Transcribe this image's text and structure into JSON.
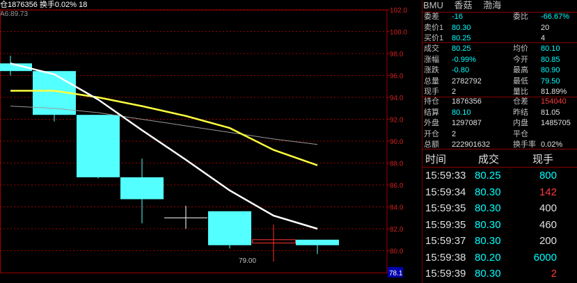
{
  "topbar": {
    "text": "仓1876356 换手0.02% 18"
  },
  "ma_legend": "A6:89.73",
  "chart_data": {
    "type": "candlestick",
    "y_ticks": [
      "102.0",
      "100.0",
      "98.0",
      "96.0",
      "94.0",
      "92.0",
      "90.0",
      "88.0",
      "86.0",
      "84.0",
      "82.0",
      "80.0"
    ],
    "ylim": [
      78.0,
      102.0
    ],
    "last_price_label": "78.1",
    "low_annotation": "79.00",
    "candles": [
      {
        "open": 96.4,
        "close": 97.1,
        "high": 97.8,
        "low": 96.0,
        "color": "cyan"
      },
      {
        "open": 96.4,
        "close": 92.4,
        "high": 96.4,
        "low": 91.8,
        "color": "cyan"
      },
      {
        "open": 92.4,
        "close": 86.7,
        "high": 92.4,
        "low": 86.6,
        "color": "cyan"
      },
      {
        "open": 86.7,
        "close": 84.7,
        "high": 88.4,
        "low": 82.5,
        "color": "cyan"
      },
      {
        "open": 83.0,
        "close": 83.0,
        "high": 84.1,
        "low": 82.0,
        "color": "cross"
      },
      {
        "open": 83.6,
        "close": 80.5,
        "high": 83.6,
        "low": 80.2,
        "color": "cyan"
      },
      {
        "open": 80.7,
        "close": 81.0,
        "high": 82.4,
        "low": 79.0,
        "color": "red"
      },
      {
        "open": 81.0,
        "close": 80.5,
        "high": 81.0,
        "low": 79.7,
        "color": "cyan"
      }
    ],
    "ma_white": [
      97.1,
      96.1,
      93.8,
      91.0,
      88.3,
      85.5,
      83.2,
      82.0
    ],
    "ma_yellow": [
      94.6,
      94.6,
      94.0,
      93.2,
      92.3,
      91.2,
      89.2,
      87.8
    ],
    "ma_gray": [
      93.2,
      93.0,
      92.6,
      92.0,
      91.4,
      90.8,
      90.2,
      89.7
    ]
  },
  "panel": {
    "title": [
      "BMU",
      "香菇",
      "渤海"
    ],
    "rows1": [
      {
        "l1": "委差",
        "v1": "-16",
        "c1": "cyan",
        "l2": "委比",
        "v2": "-66.67%",
        "c2": "cyan"
      },
      {
        "l1": "卖价1",
        "v1": "80.30",
        "c1": "cyan",
        "l2": "",
        "v2": "20",
        "c2": "white"
      },
      {
        "l1": "买价1",
        "v1": "80.25",
        "c1": "cyan",
        "l2": "",
        "v2": "4",
        "c2": "white"
      }
    ],
    "rows2": [
      {
        "l1": "成交",
        "v1": "80.25",
        "c1": "cyan",
        "l2": "均价",
        "v2": "80.10",
        "c2": "cyan"
      },
      {
        "l1": "涨幅",
        "v1": "-0.99%",
        "c1": "cyan",
        "l2": "今开",
        "v2": "80.85",
        "c2": "cyan"
      },
      {
        "l1": "涨跌",
        "v1": "-0.80",
        "c1": "cyan",
        "l2": "最高",
        "v2": "80.90",
        "c2": "cyan"
      },
      {
        "l1": "总量",
        "v1": "2782792",
        "c1": "white",
        "l2": "最低",
        "v2": "79.50",
        "c2": "cyan"
      },
      {
        "l1": "现手",
        "v1": "2",
        "c1": "white",
        "l2": "量比",
        "v2": "81.89%",
        "c2": "white"
      }
    ],
    "rows3": [
      {
        "l1": "持仓",
        "v1": "1876356",
        "c1": "white",
        "l2": "仓差",
        "v2": "154040",
        "c2": "red"
      },
      {
        "l1": "结算",
        "v1": "80.10",
        "c1": "cyan",
        "l2": "昨结",
        "v2": "81.05",
        "c2": "white"
      },
      {
        "l1": "外盘",
        "v1": "1297087",
        "c1": "white",
        "l2": "内盘",
        "v2": "1485705",
        "c2": "white"
      },
      {
        "l1": "开仓",
        "v1": "2",
        "c1": "white",
        "l2": "平仓",
        "v2": "",
        "c2": "white"
      },
      {
        "l1": "总额",
        "v1": "222901632",
        "c1": "white",
        "l2": "换手率",
        "v2": "0.02%",
        "c2": "white"
      }
    ],
    "tick_header": {
      "time": "时间",
      "price": "成交",
      "vol": "现手"
    },
    "ticks": [
      {
        "time": "15:59:33",
        "price": "80.25",
        "vol": "800",
        "vc": "cyan"
      },
      {
        "time": "15:59:34",
        "price": "80.30",
        "vol": "142",
        "vc": "red"
      },
      {
        "time": "15:59:35",
        "price": "80.30",
        "vol": "400",
        "vc": "white"
      },
      {
        "time": "15:59:35",
        "price": "80.30",
        "vol": "460",
        "vc": "white"
      },
      {
        "time": "15:59:37",
        "price": "80.30",
        "vol": "200",
        "vc": "white"
      },
      {
        "time": "15:59:38",
        "price": "80.20",
        "vol": "6000",
        "vc": "cyan"
      },
      {
        "time": "15:59:39",
        "price": "80.30",
        "vol": "2",
        "vc": "red"
      }
    ]
  }
}
